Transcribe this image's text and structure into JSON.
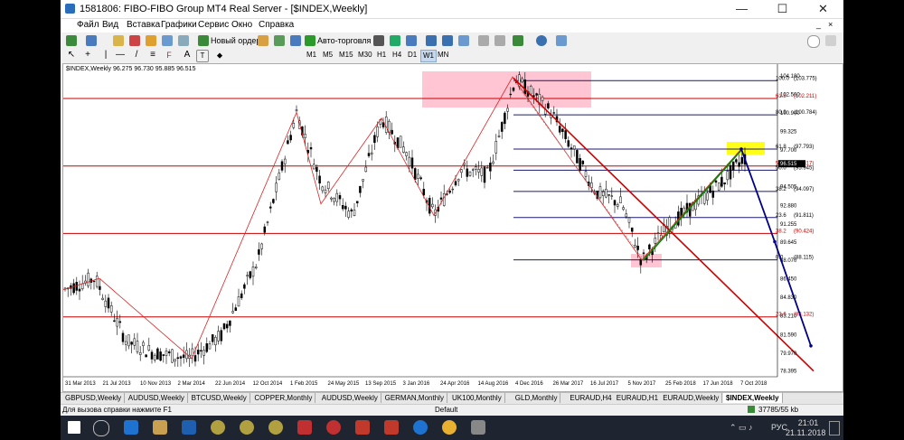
{
  "window": {
    "title": "1581806: FIBO-FIBO Group MT4 Real Server - [$INDEX,Weekly]",
    "min": "—",
    "max": "☐",
    "close": "✕"
  },
  "menu": [
    "Файл",
    "Вид",
    "Вставка",
    "Графики",
    "Сервис",
    "Окно",
    "Справка"
  ],
  "toolbar": {
    "new_order": "Новый ордер",
    "auto_trading": "Авто-торговля"
  },
  "timeframes": [
    "M1",
    "M5",
    "M15",
    "M30",
    "H1",
    "H4",
    "D1",
    "W1",
    "MN"
  ],
  "active_timeframe": "W1",
  "chart": {
    "symbol_line": "$INDEX,Weekly  96.275 96.730 95.885 96.515",
    "price_axis": [
      "104.180",
      "102.560",
      "100.940",
      "99.325",
      "97.700",
      "96.515",
      "94.505",
      "92.880",
      "91.255",
      "89.645",
      "88.070",
      "86.450",
      "84.830",
      "83.210",
      "81.590",
      "79.970",
      "78.395"
    ],
    "date_axis": [
      "31 Mar 2013",
      "21 Jul 2013",
      "10 Nov 2013",
      "2 Mar 2014",
      "22 Jun 2014",
      "12 Oct 2014",
      "1 Feb 2015",
      "24 May 2015",
      "13 Sep 2015",
      "3 Jan 2016",
      "24 Apr 2016",
      "14 Aug 2016",
      "4 Dec 2016",
      "26 Mar 2017",
      "16 Jul 2017",
      "5 Nov 2017",
      "25 Feb 2018",
      "17 Jun 2018",
      "7 Oct 2018"
    ],
    "fibo_blue": [
      {
        "level": "100.0",
        "price": "103.775"
      },
      {
        "level": "80.9",
        "price": "100.784"
      },
      {
        "level": "61.8",
        "price": "97.793"
      },
      {
        "level": "50.0",
        "price": "95.945"
      },
      {
        "level": "38.2",
        "price": "94.097"
      },
      {
        "level": "23.6",
        "price": "91.811"
      },
      {
        "level": "0.0",
        "price": "88.115"
      }
    ],
    "fibo_red": [
      {
        "level": "61.8",
        "price": "102.211"
      },
      {
        "level": "50.0",
        "price": "96.317"
      },
      {
        "level": "38.2",
        "price": "90.424"
      },
      {
        "level": "23.6",
        "price": "83.132"
      }
    ],
    "current_price": "96.515",
    "colors": {
      "up": "#000000",
      "red_line": "#cc0000",
      "blue_line": "#00008b",
      "green_line": "#008800",
      "fib_line": "#1a1a6e",
      "current_bg": "#000000"
    }
  },
  "tabs": [
    "GBPUSD,Weekly",
    "AUDUSD,Weekly",
    "BTCUSD,Weekly",
    "COPPER,Monthly",
    "AUDUSD,Weekly",
    "GERMAN,Monthly",
    "UK100,Monthly",
    "GLD,Monthly",
    "EURAUD,H4",
    "EURAUD,H1",
    "EURAUD,Weekly",
    "$INDEX,Weekly"
  ],
  "active_tab": "$INDEX,Weekly",
  "status": {
    "help": "Для вызова справки нажмите F1",
    "profile": "Default",
    "traffic": "37785/55 kb"
  },
  "taskbar": {
    "lang": "РУС",
    "time": "21:01",
    "date": "21.11.2018"
  }
}
